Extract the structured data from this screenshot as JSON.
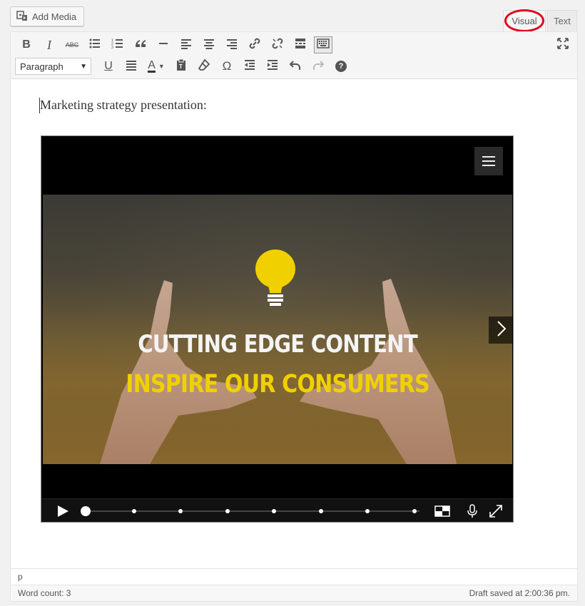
{
  "media": {
    "add_media_label": "Add Media"
  },
  "tabs": {
    "visual_label": "Visual",
    "text_label": "Text",
    "highlight_color": "#e0001b"
  },
  "toolbar": {
    "row1": [
      "bold-icon",
      "italic-icon",
      "strikethrough-icon",
      "bulleted-list-icon",
      "numbered-list-icon",
      "blockquote-icon",
      "horizontal-line-icon",
      "align-left-icon",
      "align-center-icon",
      "align-right-icon",
      "insert-link-icon",
      "remove-link-icon",
      "read-more-icon",
      "toolbar-toggle-icon"
    ],
    "row2": [
      "underline-icon",
      "justify-icon",
      "text-color-icon",
      "paste-text-icon",
      "clear-formatting-icon",
      "special-character-icon",
      "outdent-icon",
      "indent-icon",
      "undo-icon",
      "redo-icon",
      "help-icon"
    ],
    "format_value": "Paragraph",
    "italic_label": "I",
    "bold_label": "B",
    "strike_label": "ABC",
    "underline_label": "U",
    "text_color_label": "A",
    "omega_label": "Ω",
    "help_label": "?"
  },
  "content": {
    "text": "Marketing strategy presentation:"
  },
  "presentation": {
    "headline_1": "CUTTING EDGE CONTENT",
    "headline_2": "INSPIRE OUR CONSUMERS",
    "headline_1_color": "#f4f4f4",
    "headline_2_color": "#f0d000",
    "slide_count": 8,
    "current_slide": 1
  },
  "status": {
    "path": "p",
    "word_count": "Word count: 3",
    "draft_saved": "Draft saved at 2:00:36 pm."
  }
}
